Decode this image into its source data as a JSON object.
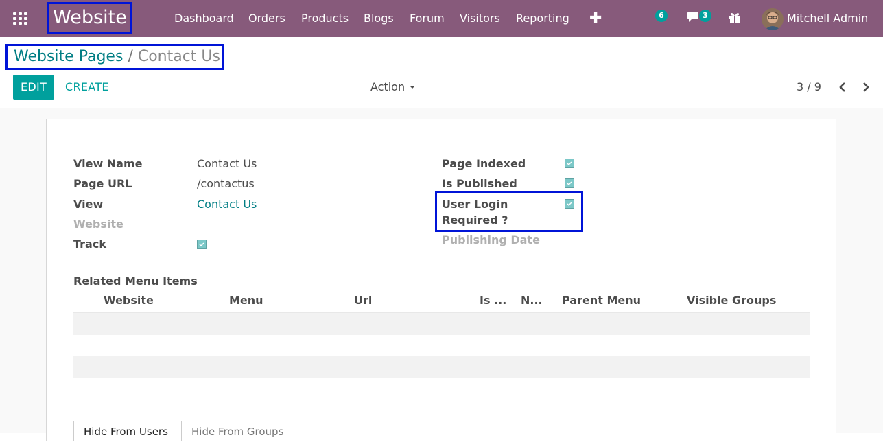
{
  "navbar": {
    "brand": "Website",
    "menu": [
      "Dashboard",
      "Orders",
      "Products",
      "Blogs",
      "Forum",
      "Visitors",
      "Reporting"
    ],
    "plus_label": "✚",
    "activity_count": "6",
    "messages_count": "3",
    "user_name": "Mitchell Admin"
  },
  "breadcrumb": {
    "parent": "Website Pages",
    "separator": "/",
    "current": "Contact Us"
  },
  "toolbar": {
    "edit_label": "EDIT",
    "create_label": "CREATE",
    "action_label": "Action",
    "pager": "3 / 9"
  },
  "form": {
    "left": {
      "view_name_label": "View Name",
      "view_name_value": "Contact Us",
      "page_url_label": "Page URL",
      "page_url_value": "/contactus",
      "view_label": "View",
      "view_value": "Contact Us",
      "website_label": "Website",
      "track_label": "Track",
      "track_checked": true
    },
    "right": {
      "page_indexed_label": "Page Indexed",
      "page_indexed_checked": true,
      "is_published_label": "Is Published",
      "is_published_checked": true,
      "login_required_label_1": "User Login",
      "login_required_label_2": "Required ?",
      "login_required_checked": true,
      "publishing_date_label": "Publishing Date"
    },
    "related_menu": {
      "title": "Related Menu Items",
      "columns": [
        "Website",
        "Menu",
        "Url",
        "Is ...",
        "N...",
        "Parent Menu",
        "Visible Groups"
      ]
    },
    "tabs": [
      "Hide From Users",
      "Hide From Groups"
    ]
  },
  "colors": {
    "navbar": "#875a7b",
    "accent": "#00a09d",
    "link": "#017e84",
    "highlight_box": "#0014d7"
  }
}
